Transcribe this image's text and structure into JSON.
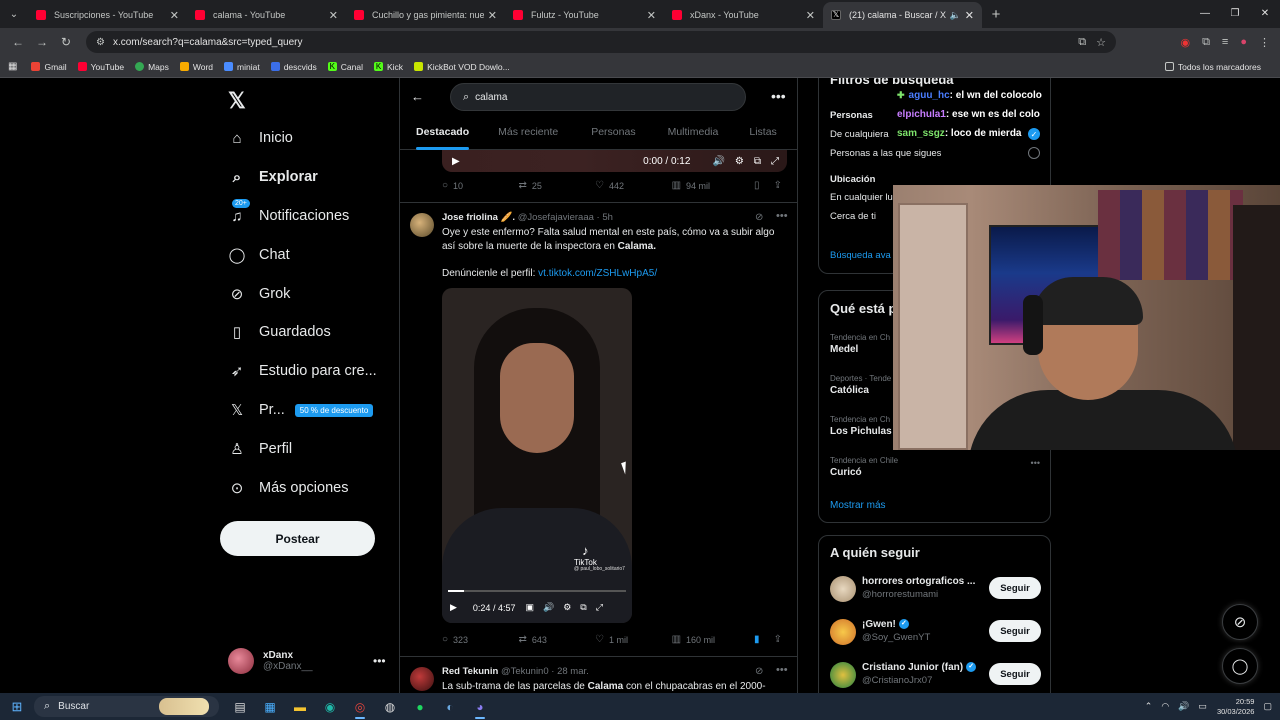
{
  "browser": {
    "tabs": [
      {
        "title": "Suscripciones - YouTube",
        "active": false
      },
      {
        "title": "calama - YouTube",
        "active": false
      },
      {
        "title": "Cuchillo y gas pimienta: nuevo",
        "active": false
      },
      {
        "title": "Fulutz - YouTube",
        "active": false
      },
      {
        "title": "xDanx - YouTube",
        "active": false
      },
      {
        "title": "(21) calama - Buscar / X",
        "active": true
      }
    ],
    "url": "x.com/search?q=calama&src=typed_query",
    "bookmarks": [
      "Gmail",
      "YouTube",
      "Maps",
      "Word",
      "miniat",
      "descvids",
      "Canal",
      "Kick",
      "KickBot VOD Dowlo..."
    ],
    "bookmarks_right": "Todos los marcadores"
  },
  "nav": {
    "items": [
      {
        "label": "Inicio",
        "icon": "home-icon"
      },
      {
        "label": "Explorar",
        "icon": "search-icon"
      },
      {
        "label": "Notificaciones",
        "icon": "bell-icon",
        "badge": "20+"
      },
      {
        "label": "Chat",
        "icon": "chat-icon"
      },
      {
        "label": "Grok",
        "icon": "grok-icon"
      },
      {
        "label": "Guardados",
        "icon": "bookmark-icon"
      },
      {
        "label": "Estudio para cre...",
        "icon": "rocket-icon"
      },
      {
        "label": "Pr...",
        "icon": "x-premium-icon",
        "promo": "50 % de descuento"
      },
      {
        "label": "Perfil",
        "icon": "person-icon"
      },
      {
        "label": "Más opciones",
        "icon": "more-circle-icon"
      }
    ],
    "post_button": "Postear",
    "account": {
      "name": "xDanx",
      "handle": "@xDanx__"
    }
  },
  "search": {
    "query": "calama"
  },
  "tabs": [
    "Destacado",
    "Más reciente",
    "Personas",
    "Multimedia",
    "Listas"
  ],
  "top_video": {
    "time": "0:00 / 0:12"
  },
  "top_actions": {
    "replies": "10",
    "reposts": "25",
    "likes": "442",
    "views": "94 mil"
  },
  "tweet1": {
    "name": "Jose friolina 🥖.",
    "handle": "@Josefajavieraaa",
    "time": "· 5h",
    "text_a": "Oye y este enfermo? Falta salud mental en este país, cómo va a subir algo así sobre la muerte de la inspectora en ",
    "text_b": "Calama.",
    "text_c": "Denúncienle el perfil: ",
    "link": "vt.tiktok.com/ZSHLwHpA5/",
    "video": {
      "time": "0:24 / 4:57",
      "tiktok": "TikTok",
      "tiktok_user": "@ paul_lobo_solitario7",
      "progress": 0.09
    },
    "actions": {
      "replies": "323",
      "reposts": "643",
      "likes": "1 mil",
      "views": "160 mil"
    }
  },
  "tweet2": {
    "name": "Red Tekunin",
    "handle": "@Tekunin0",
    "time": "· 28 mar.",
    "text_a": "La sub-trama de las parcelas de ",
    "text_b": "Calama",
    "text_c": " con el chupacabras en el 2000-"
  },
  "filters": {
    "title": "Filtros de búsqueda",
    "people_label": "Personas",
    "opt1": "De cualquiera",
    "opt2": "Personas a las que sigues",
    "location_label": "Ubicación",
    "loc1": "En cualquier lu",
    "loc2": "Cerca de ti",
    "advanced": "Búsqueda ava"
  },
  "trends": {
    "title": "Qué está p",
    "items": [
      {
        "cat": "Tendencia en Ch",
        "name": "Medel"
      },
      {
        "cat": "Deportes · Tende",
        "name": "Católica"
      },
      {
        "cat": "Tendencia en Ch",
        "name": "Los Pichulas"
      },
      {
        "cat": "Tendencia en Chile",
        "name": "Curicó"
      }
    ],
    "show_more": "Mostrar más"
  },
  "who_to_follow": {
    "title": "A quién seguir",
    "follow_label": "Seguir",
    "items": [
      {
        "name": "horrores ortograficos ...",
        "handle": "@horrorestumami",
        "verified": false
      },
      {
        "name": "¡Gwen!",
        "handle": "@Soy_GwenYT",
        "verified": true
      },
      {
        "name": "Cristiano Junior (fan)",
        "handle": "@CristianoJrx07",
        "verified": true
      }
    ]
  },
  "stream_chat": [
    {
      "user": "aguu_hc",
      "msg": ": el wn del colocolo"
    },
    {
      "user": "elpichula1",
      "msg": ": ese wn es del colo"
    },
    {
      "user": "sam_ssgz",
      "msg": ": loco de mierda"
    }
  ],
  "taskbar": {
    "search": "Buscar",
    "time": "20:59",
    "date": "30/03/2026"
  }
}
